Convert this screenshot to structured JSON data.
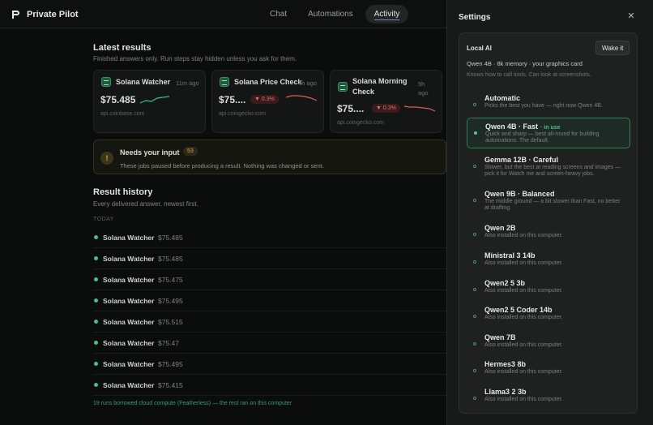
{
  "app": {
    "brand": "Private Pilot"
  },
  "nav": {
    "tabs": [
      {
        "label": "Chat"
      },
      {
        "label": "Automations"
      },
      {
        "label": "Activity"
      }
    ]
  },
  "latest": {
    "title": "Latest results",
    "subtitle": "Finished answers only. Run steps stay hidden unless you ask for them.",
    "cards": [
      {
        "name": "Solana Watcher",
        "time": "11m ago",
        "price": "$75.485",
        "source": "api.coinbase.com",
        "change": ""
      },
      {
        "name": "Solana Price Check",
        "time": "4h ago",
        "price": "$75....",
        "source": "api.coingecko.com",
        "change": "0.3%"
      },
      {
        "name": "Solana Morning Check",
        "time": "5h ago",
        "price": "$75....",
        "source": "api.coingecko.com",
        "change": "0.3%"
      }
    ]
  },
  "notice": {
    "title": "Needs your input",
    "count": "53",
    "text": "These jobs paused before producing a result. Nothing was changed or sent."
  },
  "history": {
    "title": "Result history",
    "subtitle": "Every delivered answer, newest first.",
    "group": "TODAY",
    "rows": [
      {
        "name": "Solana Watcher",
        "value": "$75.485"
      },
      {
        "name": "Solana Watcher",
        "value": "$75.485"
      },
      {
        "name": "Solana Watcher",
        "value": "$75.475"
      },
      {
        "name": "Solana Watcher",
        "value": "$75.495"
      },
      {
        "name": "Solana Watcher",
        "value": "$75.515"
      },
      {
        "name": "Solana Watcher",
        "value": "$75.47"
      },
      {
        "name": "Solana Watcher",
        "value": "$75.495"
      },
      {
        "name": "Solana Watcher",
        "value": "$75.415"
      }
    ],
    "footnote": "19 runs borrowed cloud compute (Featherless) — the rest ran on this computer"
  },
  "settings": {
    "title": "Settings",
    "local_ai": {
      "label": "Local AI",
      "wake_label": "Wake it",
      "meta": "Qwen 4B · 8k memory · your graphics card",
      "capabilities": "Knows how to call tools. Can look at screenshots.",
      "options": [
        {
          "name": "Automatic",
          "desc": "Picks the best you have — right now Qwen 4B.",
          "selected": false
        },
        {
          "name": "Qwen 4B · Fast",
          "badge": "· in use",
          "desc": "Quick and sharp — best all-round for building automations. The default.",
          "selected": true
        },
        {
          "name": "Gemma 12B · Careful",
          "desc": "Slower, but the best at reading screens and images — pick it for Watch me and screen-heavy jobs.",
          "selected": false
        },
        {
          "name": "Qwen 9B · Balanced",
          "desc": "The middle ground — a bit slower than Fast, no better at drafting.",
          "selected": false
        },
        {
          "name": "Qwen 2B",
          "desc": "Also installed on this computer.",
          "selected": false
        },
        {
          "name": "Ministral 3 14b",
          "desc": "Also installed on this computer.",
          "selected": false
        },
        {
          "name": "Qwen2 5 3b",
          "desc": "Also installed on this computer.",
          "selected": false
        },
        {
          "name": "Qwen2 5 Coder 14b",
          "desc": "Also installed on this computer.",
          "selected": false
        },
        {
          "name": "Qwen 7B",
          "desc": "Also installed on this computer.",
          "selected": false
        },
        {
          "name": "Hermes3 8b",
          "desc": "Also installed on this computer.",
          "selected": false
        },
        {
          "name": "Llama3 2 3b",
          "desc": "Also installed on this computer.",
          "selected": false
        }
      ]
    }
  },
  "colors": {
    "accent_green": "#4bbf86",
    "down_red": "#e07070",
    "warning": "#d8b24a"
  }
}
